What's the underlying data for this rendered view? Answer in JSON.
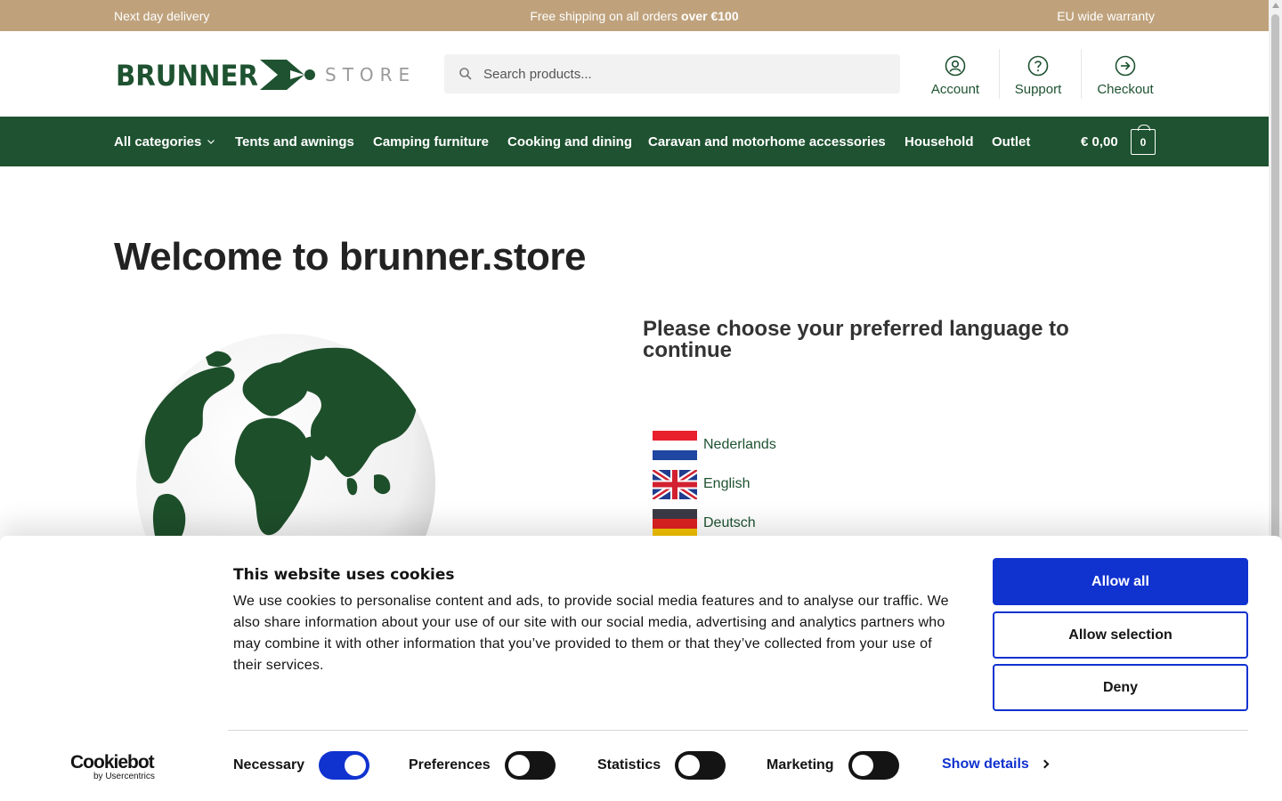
{
  "topbar": {
    "left": "Next day delivery",
    "center_prefix": "Free shipping on all orders ",
    "center_bold": "over €100",
    "right": "EU wide warranty"
  },
  "header": {
    "logo_text": "BRUNNER",
    "logo_suffix": "STORE",
    "search_placeholder": "Search products...",
    "links": [
      {
        "label": "Account",
        "icon": "user-circle-icon"
      },
      {
        "label": "Support",
        "icon": "help-circle-icon"
      },
      {
        "label": "Checkout",
        "icon": "arrow-circle-right-icon"
      }
    ]
  },
  "nav": {
    "items": [
      "All categories",
      "Tents and awnings",
      "Camping furniture",
      "Cooking and dining",
      "Caravan and motorhome accessories",
      "Household",
      "Outlet"
    ],
    "cart_total": "€ 0,00",
    "cart_count": "0"
  },
  "main": {
    "title": "Welcome to brunner.store",
    "choose_language": "Please choose your preferred language to continue",
    "languages": [
      {
        "label": "Nederlands",
        "flag": "flag-nl-icon"
      },
      {
        "label": "English",
        "flag": "flag-uk-icon"
      },
      {
        "label": "Deutsch",
        "flag": "flag-de-icon"
      }
    ]
  },
  "cookie": {
    "title": "This website uses cookies",
    "text": "We use cookies to personalise content and ads, to provide social media features and to analyse our traffic. We also share information about your use of our site with our social media, advertising and analytics partners who may combine it with other information that you’ve provided to them or that they’ve collected from your use of their services.",
    "buttons": {
      "allow_all": "Allow all",
      "allow_selection": "Allow selection",
      "deny": "Deny"
    },
    "provider": "Cookiebot",
    "provider_sub": "by Usercentrics",
    "toggles": [
      {
        "label": "Necessary",
        "on": true
      },
      {
        "label": "Preferences",
        "on": false
      },
      {
        "label": "Statistics",
        "on": false
      },
      {
        "label": "Marketing",
        "on": false
      }
    ],
    "show_details": "Show details"
  },
  "colors": {
    "topbar": "#bfa27c",
    "brand_green": "#1e5230",
    "cookie_blue": "#1032cf"
  }
}
